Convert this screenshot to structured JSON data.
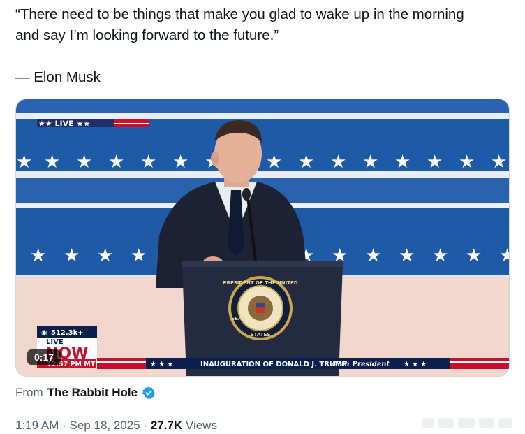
{
  "tweet": {
    "quote_line1": "“There need to be things that make you glad to wake up in the morning",
    "quote_line2": "and say I’m looking forward to the future.”",
    "attribution": "— Elon Musk"
  },
  "video": {
    "duration": "0:17",
    "live_bug": "★★ LIVE ★★",
    "views_overlay": "512.3k+",
    "live_word": "LIVE",
    "now_word": "NOW",
    "time_mt": "12:57 PM MT",
    "ticker_text": "INAUGURATION OF DONALD J. TRUMP",
    "ticker_sub": "47th President",
    "seal_top": "PRESIDENT OF THE UNITED",
    "seal_bottom": "STATES",
    "seal_left": "SEAL"
  },
  "source": {
    "prefix": "From",
    "name": "The Rabbit Hole"
  },
  "meta": {
    "time": "1:19 AM",
    "sep1": "·",
    "date": "Sep 18, 2025",
    "sep2": "·",
    "views_count": "27.7K",
    "views_label": "Views"
  },
  "colors": {
    "stripe_blue": "#1f5aa6",
    "stripe_light": "#e8ecf4",
    "verified_blue": "#1d9bf0",
    "ticker_red": "#c8102e",
    "ticker_navy": "#0b1f4d"
  }
}
